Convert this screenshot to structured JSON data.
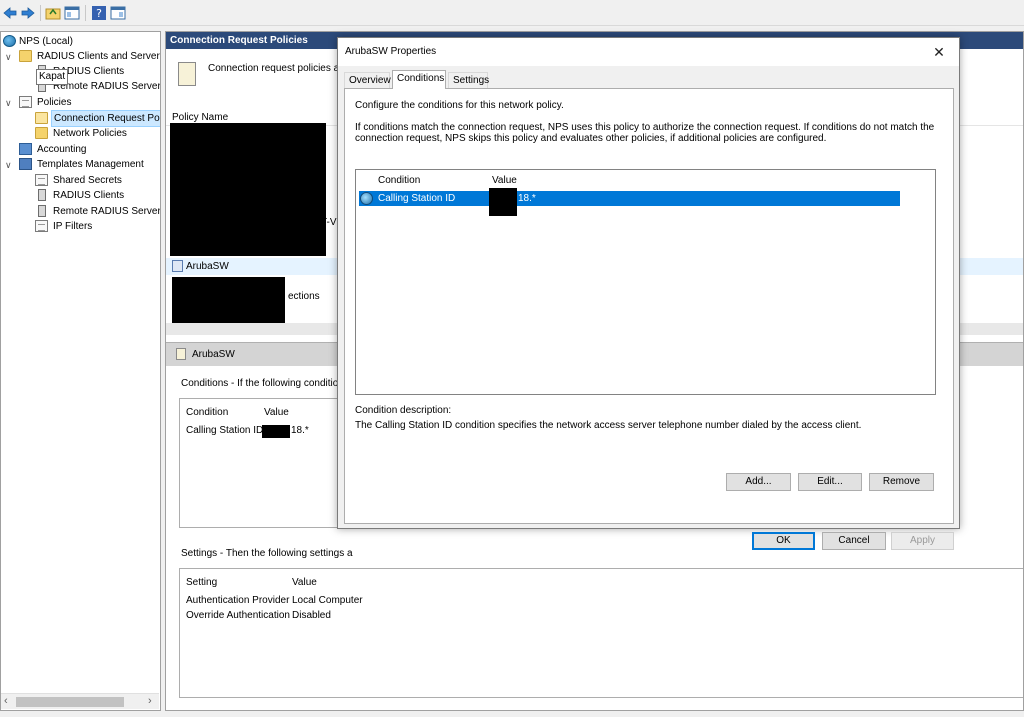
{
  "toolbar": {
    "icons": [
      "back-arrow-icon",
      "forward-arrow-icon",
      "up-folder-icon",
      "show-hide-tree-icon",
      "help-icon",
      "properties-pane-icon"
    ]
  },
  "tree": {
    "items": [
      {
        "label": "NPS (Local)",
        "icon": "globe-icon"
      },
      {
        "label": "RADIUS Clients and Servers",
        "icon": "folder-icon"
      },
      {
        "label": "RADIUS Clients",
        "icon": "server-icon"
      },
      {
        "label": "Remote RADIUS Server",
        "icon": "server-icon"
      },
      {
        "label": "Policies",
        "icon": "document-icon"
      },
      {
        "label": "Connection Request Po",
        "icon": "folder-open-icon"
      },
      {
        "label": "Network Policies",
        "icon": "folder-icon"
      },
      {
        "label": "Accounting",
        "icon": "accounting-icon"
      },
      {
        "label": "Templates Management",
        "icon": "templates-icon"
      },
      {
        "label": "Shared Secrets",
        "icon": "document-icon"
      },
      {
        "label": "RADIUS Clients",
        "icon": "server-icon"
      },
      {
        "label": "Remote RADIUS Servers",
        "icon": "server-icon"
      },
      {
        "label": "IP Filters",
        "icon": "document-icon"
      }
    ],
    "tooltip": "Kapat"
  },
  "main": {
    "title": "Connection Request Policies",
    "banner_text": "Connection request policies allo",
    "column_policy_name": "Policy Name",
    "partial_text_1": "T-V",
    "row_policy": "ArubaSW",
    "partial_text_2": "ections",
    "details_title": "ArubaSW",
    "conditions_caption": "Conditions - If the following conditions a",
    "conditions": {
      "head_condition": "Condition",
      "head_value": "Value",
      "row_condition": "Calling Station ID",
      "row_value_suffix": "18.*"
    },
    "settings_caption": "Settings - Then the following settings a",
    "settings": {
      "head_setting": "Setting",
      "head_value": "Value",
      "rows": [
        {
          "setting": "Authentication Provider",
          "value": "Local Computer"
        },
        {
          "setting": "Override Authentication",
          "value": "Disabled"
        }
      ]
    }
  },
  "dialog": {
    "title": "ArubaSW Properties",
    "close": "✕",
    "tabs": [
      "Overview",
      "Conditions",
      "Settings"
    ],
    "active_tab": "Conditions",
    "intro": "Configure the conditions for this network policy.",
    "explain_1": "If conditions match the connection request, NPS uses this policy to authorize the connection request. If conditions do not match the",
    "explain_2": "connection request, NPS skips this policy and evaluates other policies, if additional policies are configured.",
    "list": {
      "head_condition": "Condition",
      "head_value": "Value",
      "row_condition": "Calling Station ID",
      "row_value_suffix": "18.*"
    },
    "desc_label": "Condition description:",
    "desc_text": "The Calling Station ID condition specifies the network access server telephone number dialed by the access client.",
    "buttons": {
      "add": "Add...",
      "edit": "Edit...",
      "remove": "Remove"
    },
    "footer": {
      "ok": "OK",
      "cancel": "Cancel",
      "apply": "Apply"
    }
  }
}
